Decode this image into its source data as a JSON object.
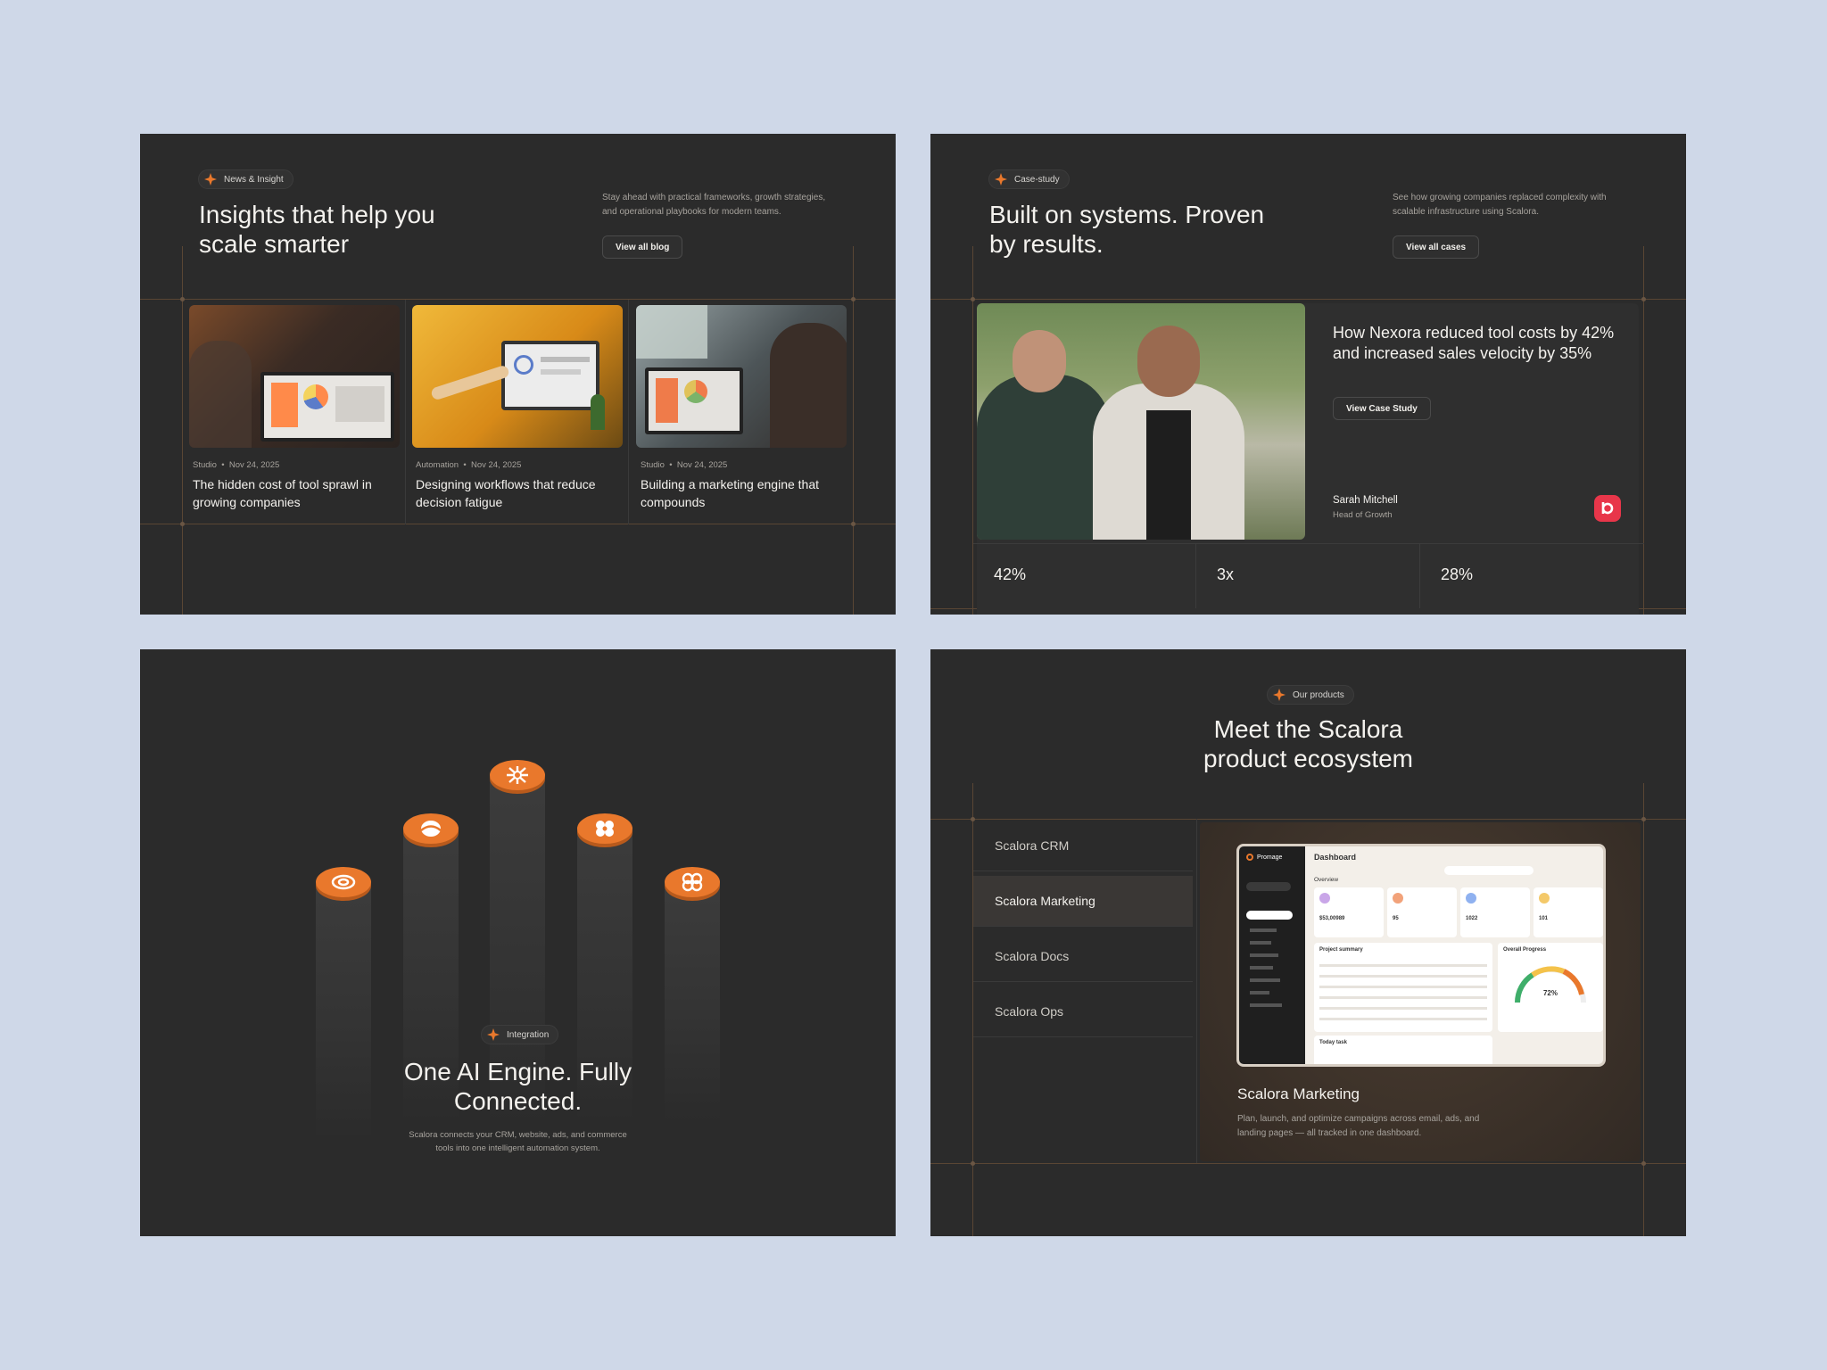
{
  "insights": {
    "badge": "News & Insight",
    "title_line1": "Insights that help you",
    "title_line2": "scale smarter",
    "lead_line1": "Stay ahead with practical frameworks, growth strategies,",
    "lead_line2": "and operational playbooks for modern teams.",
    "button": "View all blog",
    "cards": [
      {
        "category": "Studio",
        "date": "Nov 24, 2025",
        "title": "The hidden cost of tool sprawl in growing companies"
      },
      {
        "category": "Automation",
        "date": "Nov 24, 2025",
        "title": "Designing workflows that reduce decision fatigue"
      },
      {
        "category": "Studio",
        "date": "Nov 24, 2025",
        "title": "Building a marketing engine that compounds"
      }
    ]
  },
  "casestudy": {
    "badge": "Case-study",
    "title_line1": "Built on systems. Proven",
    "title_line2": "by results.",
    "lead_line1": "See how growing companies replaced complexity with",
    "lead_line2": "scalable infrastructure using Scalora.",
    "button": "View all cases",
    "headline": "How Nexora reduced tool costs by 42% and increased sales velocity by 35%",
    "cta": "View Case Study",
    "person_name": "Sarah Mitchell",
    "person_role": "Head of Growth",
    "stats": [
      "42%",
      "3x",
      "28%"
    ]
  },
  "integration": {
    "badge": "Integration",
    "title_line1": "One AI Engine. Fully",
    "title_line2": "Connected.",
    "lead_line1": "Scalora connects your CRM, website, ads, and commerce",
    "lead_line2": "tools into one intelligent automation system."
  },
  "products": {
    "badge": "Our products",
    "title_line1": "Meet the Scalora",
    "title_line2": "product ecosystem",
    "tabs": [
      "Scalora CRM",
      "Scalora Marketing",
      "Scalora Docs",
      "Scalora Ops"
    ],
    "active_tab": "Scalora Marketing",
    "detail_title": "Scalora Marketing",
    "detail_line1": "Plan, launch, and optimize campaigns across email, ads, and",
    "detail_line2": "landing pages — all tracked in one dashboard.",
    "dashboard": {
      "brand": "Promage",
      "heading": "Dashboard",
      "overview": "Overview",
      "kpis": [
        "$53,00989",
        "95",
        "1022",
        "101"
      ],
      "project_summary": "Project summary",
      "overall_progress": "Overall Progress",
      "progress": "72%",
      "today_task": "Today task"
    }
  },
  "colors": {
    "accent": "#e9782c",
    "panel": "#2b2b2b",
    "background": "#cfd8e8"
  }
}
